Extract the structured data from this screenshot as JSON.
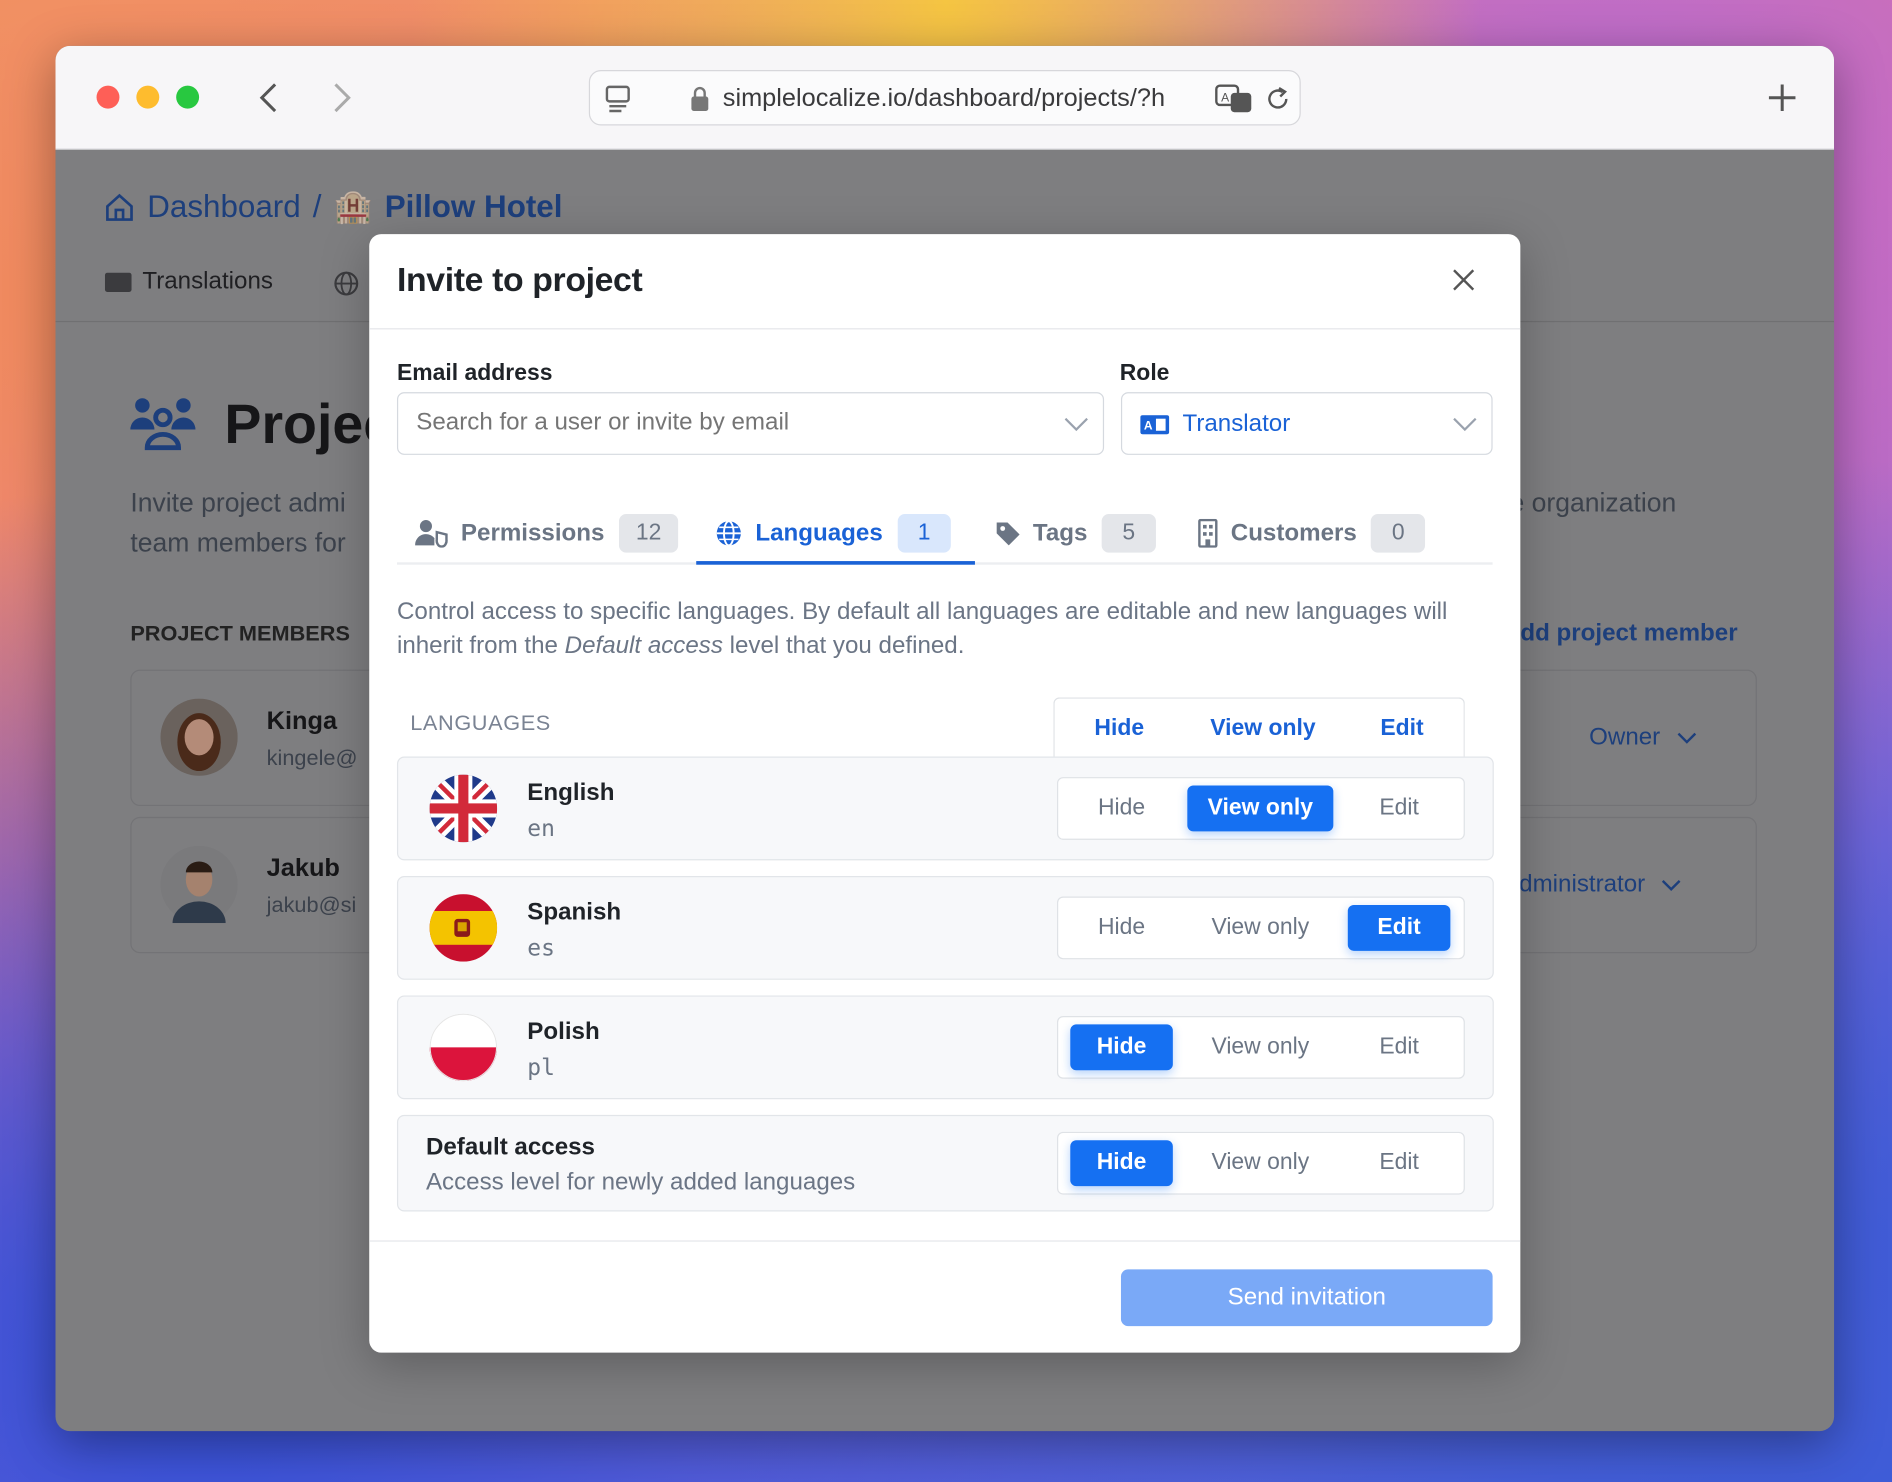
{
  "browser": {
    "url": "simplelocalize.io/dashboard/projects/?h"
  },
  "background_page": {
    "breadcrumb": {
      "home": "Dashboard",
      "separator": "/",
      "emoji": "🏨",
      "project": "Pillow Hotel"
    },
    "nav": {
      "translations": "Translations"
    },
    "page_title": "Projec",
    "description_line1": "Invite project admi",
    "description_line1_right": "e organization",
    "description_line2": "team members for",
    "members_heading": "PROJECT MEMBERS",
    "add_member_link": "dd project member",
    "members": [
      {
        "name": "Kinga",
        "email": "kingele@",
        "role": "Owner"
      },
      {
        "name": "Jakub",
        "email": "jakub@si",
        "role": "dministrator"
      }
    ]
  },
  "modal": {
    "title": "Invite to project",
    "email_label": "Email address",
    "email_placeholder": "Search for a user or invite by email",
    "email_value": "",
    "role_label": "Role",
    "role_value": "Translator",
    "tabs": [
      {
        "label": "Permissions",
        "count": "12",
        "icon": "user-shield-icon",
        "active": false
      },
      {
        "label": "Languages",
        "count": "1",
        "icon": "globe-icon",
        "active": true
      },
      {
        "label": "Tags",
        "count": "5",
        "icon": "tag-icon",
        "active": false
      },
      {
        "label": "Customers",
        "count": "0",
        "icon": "building-icon",
        "active": false
      }
    ],
    "description_part1": "Control access to specific languages. By default all languages are editable and new languages will inherit from the ",
    "description_em": "Default access",
    "description_part2": " level that you defined.",
    "languages_header": "LANGUAGES",
    "bulk": {
      "hide": "Hide",
      "view": "View only",
      "edit": "Edit"
    },
    "options": {
      "hide": "Hide",
      "view": "View only",
      "edit": "Edit"
    },
    "languages": [
      {
        "name": "English",
        "code": "en",
        "access": "view"
      },
      {
        "name": "Spanish",
        "code": "es",
        "access": "edit"
      },
      {
        "name": "Polish",
        "code": "pl",
        "access": "hide"
      }
    ],
    "default_access": {
      "title": "Default access",
      "subtitle": "Access level for newly added languages",
      "access": "hide"
    },
    "submit": "Send invitation"
  },
  "colors": {
    "accent": "#1570f2",
    "submit_disabled": "#7aa9f7"
  }
}
